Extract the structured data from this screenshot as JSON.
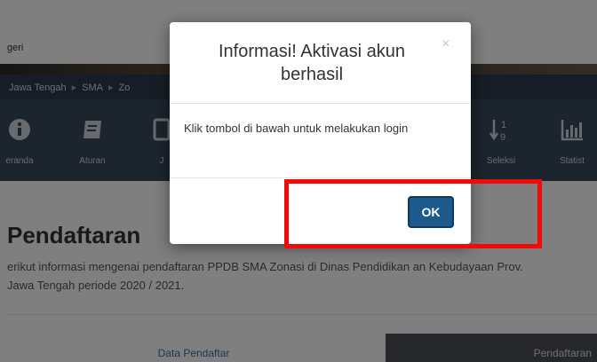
{
  "header": {
    "site_name": "geri"
  },
  "breadcrumb": {
    "items": [
      "Jawa Tengah",
      "SMA",
      "Zo"
    ],
    "separator": "▸"
  },
  "nav": {
    "items": [
      {
        "label": "eranda",
        "icon": "info-icon"
      },
      {
        "label": "Aturan",
        "icon": "book-icon"
      },
      {
        "label": "J",
        "icon": "document-icon"
      },
      {
        "label": "Seleksi",
        "icon": "sort-numeric-icon"
      },
      {
        "label": "Statist",
        "icon": "bar-chart-icon"
      }
    ]
  },
  "section": {
    "title": "Pendaftaran",
    "description": "erikut informasi mengenai pendaftaran PPDB SMA Zonasi di Dinas Pendidikan an Kebudayaan Prov. Jawa Tengah periode 2020 / 2021.",
    "tabs": [
      "Data Pendaftar",
      "Pendaftaran"
    ]
  },
  "modal": {
    "title": "Informasi! Aktivasi akun berhasil",
    "close": "×",
    "message": "Klik tombol di bawah untuk melakukan login",
    "ok_label": "OK"
  },
  "colors": {
    "highlight": "#f00a0a",
    "ok_button": "#1d5a8c",
    "nav_bg": "#39485c"
  }
}
